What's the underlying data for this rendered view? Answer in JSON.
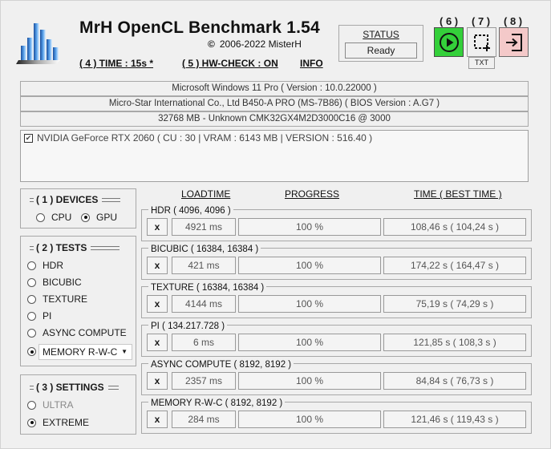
{
  "header": {
    "title": "MrH OpenCL Benchmark 1.54",
    "copyright_symbol": "©",
    "copyright": "2006-2022 MisterH",
    "time_link": "( 4 ) TIME : 15s *",
    "hwcheck_link": "( 5 ) HW-CHECK : ON",
    "info_link": "INFO"
  },
  "status": {
    "label": "STATUS",
    "value": "Ready"
  },
  "toolbar": {
    "run_num": "( 6 )",
    "crop_num": "( 7 )",
    "exit_num": "( 8 )",
    "txt_label": "TXT"
  },
  "system_info": {
    "os": "Microsoft Windows 11 Pro ( Version : 10.0.22000 )",
    "board": "Micro-Star International Co., Ltd B450-A PRO (MS-7B86) ( BIOS Version : A.G7 )",
    "memory": "32768 MB - Unknown CMK32GX4M2D3000C16   @ 3000"
  },
  "gpu_list": [
    {
      "checked": true,
      "label": "NVIDIA GeForce RTX 2060 ( CU : 30 | VRAM : 6143 MB | VERSION : 516.40 )"
    }
  ],
  "devices": {
    "title": "( 1 ) DEVICES",
    "cpu": "CPU",
    "gpu": "GPU",
    "selected": "GPU"
  },
  "tests_group": {
    "title": "( 2 ) TESTS",
    "items": [
      "HDR",
      "BICUBIC",
      "TEXTURE",
      "PI",
      "ASYNC COMPUTE"
    ],
    "selected": "MEMORY R-W-C",
    "combo_value": "MEMORY R-W-C"
  },
  "settings": {
    "title": "( 3 ) SETTINGS",
    "ultra": "ULTRA",
    "extreme": "EXTREME",
    "selected": "EXTREME"
  },
  "results_header": {
    "loadtime": "LOADTIME",
    "progress": "PROGRESS",
    "time": "TIME ( BEST TIME )"
  },
  "results": [
    {
      "name": "HDR ( 4096, 4096 )",
      "x": "x",
      "loadtime": "4921 ms",
      "progress": "100 %",
      "time": "108,46 s ( 104,24 s )"
    },
    {
      "name": "BICUBIC ( 16384, 16384 )",
      "x": "x",
      "loadtime": "421 ms",
      "progress": "100 %",
      "time": "174,22 s ( 164,47 s )"
    },
    {
      "name": "TEXTURE ( 16384, 16384 )",
      "x": "x",
      "loadtime": "4144 ms",
      "progress": "100 %",
      "time": "75,19 s ( 74,29 s )"
    },
    {
      "name": "PI ( 134.217.728 )",
      "x": "x",
      "loadtime": "6 ms",
      "progress": "100 %",
      "time": "121,85 s ( 108,3 s )"
    },
    {
      "name": "ASYNC COMPUTE ( 8192, 8192 )",
      "x": "x",
      "loadtime": "2357 ms",
      "progress": "100 %",
      "time": "84,84 s ( 76,73 s )"
    },
    {
      "name": "MEMORY R-W-C ( 8192, 8192 )",
      "x": "x",
      "loadtime": "284 ms",
      "progress": "100 %",
      "time": "121,46 s ( 119,43 s )"
    }
  ],
  "colors": {
    "run_button": "#34d03a",
    "exit_button": "#f4c9c9",
    "logo_blue": "#1f5fb0"
  },
  "icons": {
    "run": "play-icon",
    "crop": "crop-icon",
    "exit": "exit-icon",
    "logo": "bar-chart-logo-icon"
  }
}
